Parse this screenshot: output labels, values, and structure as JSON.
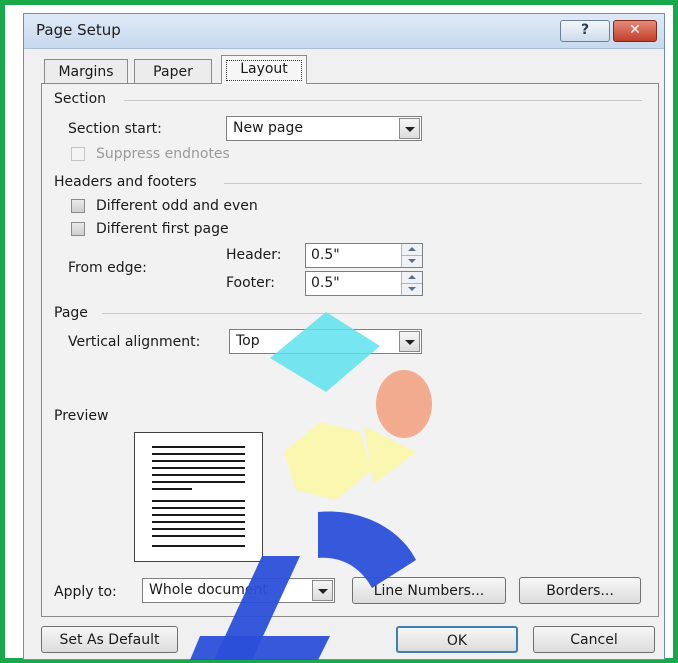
{
  "window": {
    "title": "Page Setup",
    "help_glyph": "?",
    "close_glyph": "✕"
  },
  "tabs": [
    {
      "label": "Margins",
      "selected": false
    },
    {
      "label": "Paper",
      "selected": false
    },
    {
      "label": "Layout",
      "selected": true
    }
  ],
  "section": {
    "heading": "Section",
    "start_label": "Section start:",
    "start_value": "New page",
    "suppress_endnotes_label": "Suppress endnotes",
    "suppress_endnotes_enabled": false
  },
  "headers_footers": {
    "heading": "Headers and footers",
    "odd_even_label": "Different odd and even",
    "odd_even_checked": false,
    "first_page_label": "Different first page",
    "first_page_checked": false,
    "from_edge_label": "From edge:",
    "header_label": "Header:",
    "header_value": "0.5\"",
    "footer_label": "Footer:",
    "footer_value": "0.5\""
  },
  "page": {
    "heading": "Page",
    "vertical_alignment_label": "Vertical alignment:",
    "vertical_alignment_value": "Top"
  },
  "preview": {
    "heading": "Preview"
  },
  "apply": {
    "label": "Apply to:",
    "value": "Whole document",
    "line_numbers_button": "Line Numbers...",
    "borders_button": "Borders..."
  },
  "footer_buttons": {
    "set_default": "Set As Default",
    "ok": "OK",
    "cancel": "Cancel"
  },
  "colors": {
    "frame_border": "#19a84a",
    "title_bar": "#c7d9ee",
    "close_button": "#c03f2b",
    "watermark_cyan": "#5ee3ef",
    "watermark_salmon": "#f2a383",
    "watermark_yellow": "#fbf7a8",
    "watermark_blue": "#2b4fd9"
  }
}
